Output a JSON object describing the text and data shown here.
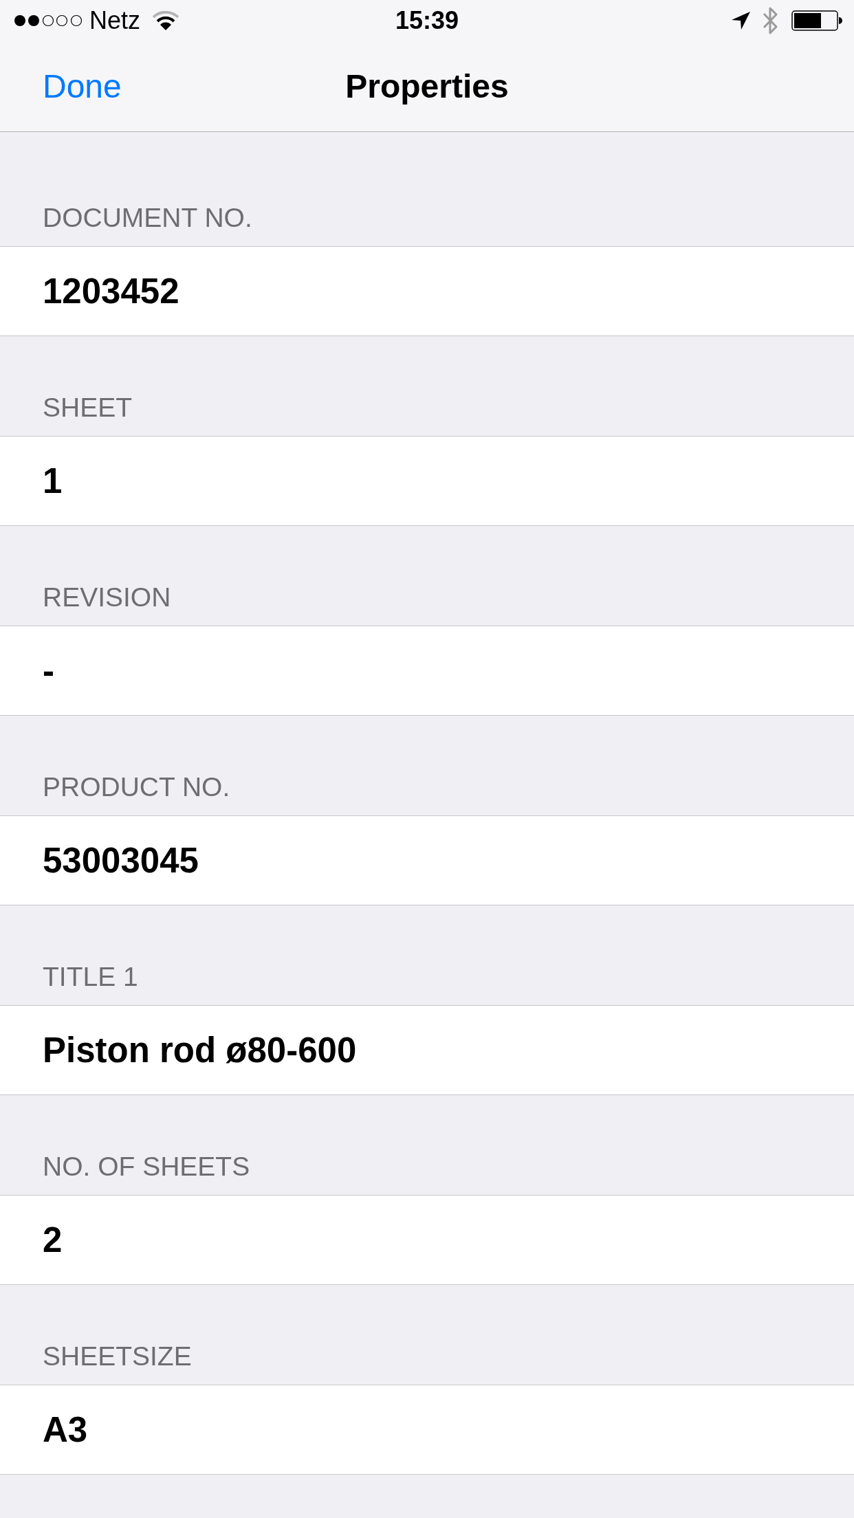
{
  "status_bar": {
    "carrier": "Netz",
    "time": "15:39"
  },
  "nav_bar": {
    "left_button": "Done",
    "title": "Properties"
  },
  "sections": [
    {
      "header": "DOCUMENT NO.",
      "value": "1203452"
    },
    {
      "header": "SHEET",
      "value": "1"
    },
    {
      "header": "REVISION",
      "value": "-"
    },
    {
      "header": "PRODUCT NO.",
      "value": "53003045"
    },
    {
      "header": "TITLE 1",
      "value": "Piston rod ø80-600"
    },
    {
      "header": "NO. OF SHEETS",
      "value": "2"
    },
    {
      "header": "SHEETSIZE",
      "value": "A3"
    }
  ]
}
